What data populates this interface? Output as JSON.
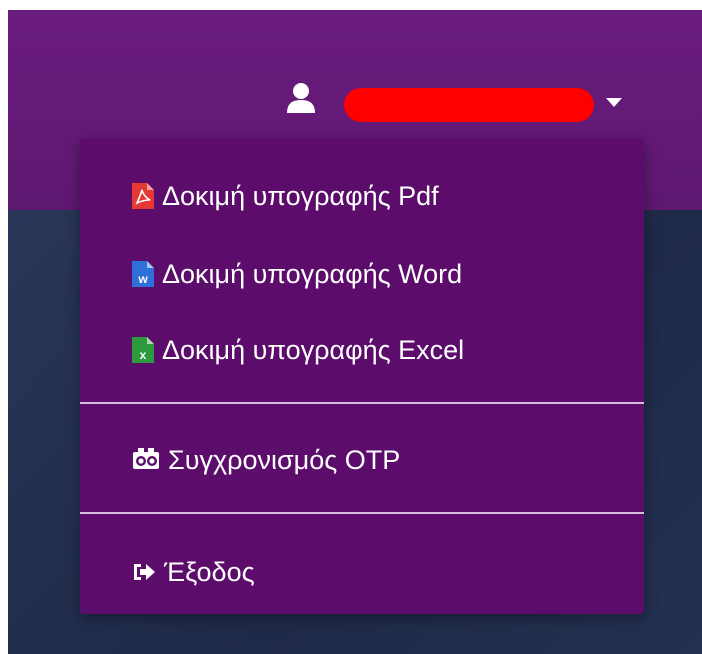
{
  "navbar": {
    "bg_color": "#641a77",
    "user": {
      "icon": "user-icon",
      "name": "",
      "name_redaction_color": "#ff0000",
      "caret_icon": "caret-down-icon"
    }
  },
  "dropdown": {
    "bg_color": "#5c0d6b",
    "items": [
      {
        "label": "Δοκιμή υπογραφής Pdf",
        "icon": "pdf-file-icon",
        "icon_color": "#e53935"
      },
      {
        "label": "Δοκιμή υπογραφής Word",
        "icon": "word-file-icon",
        "icon_color": "#2f6fd8"
      },
      {
        "label": "Δοκιμή υπογραφής Excel",
        "icon": "excel-file-icon",
        "icon_color": "#2e9a3e"
      },
      {
        "label": "Συγχρονισμός OTP",
        "icon": "otp-device-icon",
        "icon_color": "#ffffff"
      },
      {
        "label": "Έξοδος",
        "icon": "sign-out-icon",
        "icon_color": "#ffffff"
      }
    ]
  }
}
